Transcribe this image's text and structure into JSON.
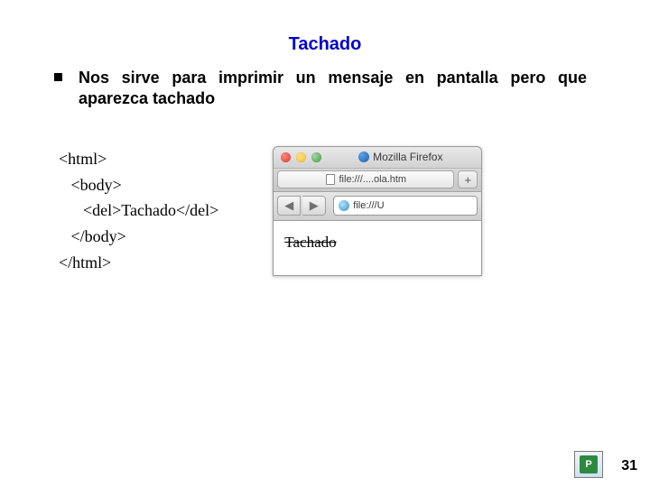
{
  "title": "Tachado",
  "bullet": "Nos sirve para imprimir un mensaje en pantalla pero que aparezca tachado",
  "code": "<html>\n   <body>\n      <del>Tachado</del>\n   </body>\n</html>",
  "browser": {
    "app_title": "Mozilla Firefox",
    "tab_label": "file:///....ola.htm",
    "newtab_symbol": "+",
    "back_symbol": "◀",
    "forward_symbol": "▶",
    "url": "file:///U",
    "page_content": "Tachado"
  },
  "page_number": "31",
  "logo_letter": "P"
}
